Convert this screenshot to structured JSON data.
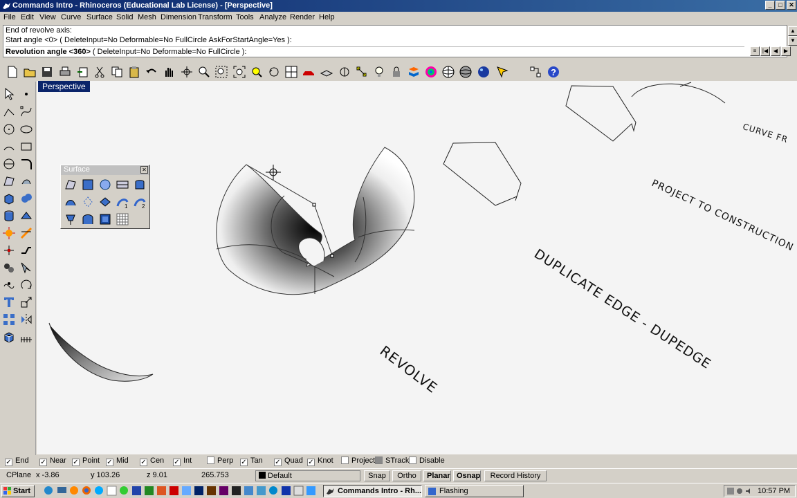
{
  "window": {
    "title": "Commands Intro - Rhinoceros (Educational Lab License) - [Perspective]",
    "buttons": [
      "_",
      "□",
      "✕"
    ]
  },
  "menu": [
    "File",
    "Edit",
    "View",
    "Curve",
    "Surface",
    "Solid",
    "Mesh",
    "Dimension",
    "Transform",
    "Tools",
    "Analyze",
    "Render",
    "Help"
  ],
  "command": {
    "history": [
      "End of revolve axis:",
      "Start angle <0> ( DeleteInput=No  Deformable=No  FullCircle  AskForStartAngle=Yes ):"
    ],
    "prompt_label": "Revolution angle <360>",
    "prompt_options": " ( DeleteInput=No  Deformable=No  FullCircle ): "
  },
  "viewport": {
    "name": "Perspective",
    "labels": {
      "curve_from": "CURVE FR",
      "project": "PROJECT TO CONSTRUCTION",
      "dupedge": "DUPLICATE EDGE - DUPEDGE",
      "revolve": "REVOLVE"
    }
  },
  "surface_palette": {
    "title": "Surface",
    "close": "✕"
  },
  "osnaps": [
    {
      "label": "End",
      "checked": true
    },
    {
      "label": "Near",
      "checked": true
    },
    {
      "label": "Point",
      "checked": true
    },
    {
      "label": "Mid",
      "checked": true
    },
    {
      "label": "Cen",
      "checked": true
    },
    {
      "label": "Int",
      "checked": true
    },
    {
      "label": "Perp",
      "checked": false
    },
    {
      "label": "Tan",
      "checked": true
    },
    {
      "label": "Quad",
      "checked": true
    },
    {
      "label": "Knot",
      "checked": true
    },
    {
      "label": "Project",
      "checked": false
    },
    {
      "label": "STrack",
      "checked": false
    },
    {
      "label": "Disable",
      "checked": false
    }
  ],
  "status": {
    "cplane": "CPlane",
    "x": "x -3.86",
    "y": "y 103.26",
    "z": "z 9.01",
    "distance": "265.753",
    "layer": "Default",
    "snap": "Snap",
    "ortho": "Ortho",
    "planar": "Planar",
    "osnap": "Osnap",
    "record_history": "Record History"
  },
  "taskbar": {
    "start": "Start",
    "tasks": [
      "Commands Intro - Rh...",
      "Flashing"
    ],
    "clock": "10:57 PM"
  },
  "colors": {
    "titlebar_start": "#0a246a",
    "titlebar_end": "#3a6ea5",
    "chrome": "#d4d0c8",
    "viewport_bg": "#f4f4f4"
  }
}
